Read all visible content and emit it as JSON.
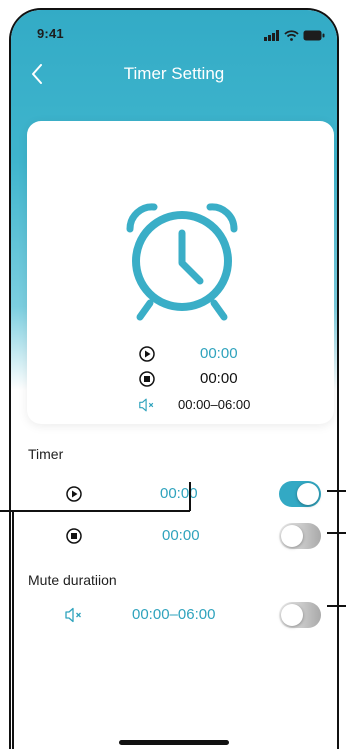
{
  "status_bar": {
    "time": "9:41",
    "icons": [
      "signal-icon",
      "wifi-icon",
      "battery-icon"
    ]
  },
  "header": {
    "title": "Timer Setting",
    "back_icon": "chevron-left-icon"
  },
  "summary_card": {
    "clock_icon": "alarm-clock-icon",
    "start_time": "00:00",
    "stop_time": "00:00",
    "mute_duration": "00:00–06:00"
  },
  "timer_section": {
    "label": "Timer",
    "start": {
      "icon": "play-icon",
      "value": "00:00",
      "enabled": true
    },
    "stop": {
      "icon": "stop-icon",
      "value": "00:00",
      "enabled": false
    }
  },
  "mute_section": {
    "label": "Mute duratiion",
    "icon": "mute-icon",
    "value": "00:00–06:00",
    "enabled": false
  },
  "colors": {
    "accent": "#33a9c4",
    "accent_text": "#2fa3bd",
    "header_gradient_top": "#33abc6"
  }
}
